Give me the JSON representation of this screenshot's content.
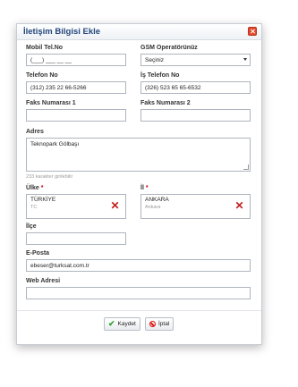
{
  "dialog": {
    "title": "İletişim Bilgisi Ekle"
  },
  "fields": {
    "mobile": {
      "label": "Mobil Tel.No",
      "value": "(___) ___ __ __"
    },
    "gsm_operator": {
      "label": "GSM Operatörünüz",
      "value": "Seçiniz"
    },
    "phone": {
      "label": "Telefon No",
      "value": "(312) 235 22 66-5266"
    },
    "work_phone": {
      "label": "İş Telefon No",
      "value": "(326) 523 65 65-6532"
    },
    "fax1": {
      "label": "Faks Numarası 1",
      "value": ""
    },
    "fax2": {
      "label": "Faks Numarası 2",
      "value": ""
    },
    "address": {
      "label": "Adres",
      "value": "Teknopark Gölbaşı",
      "hint": "233 karakter girilebilir"
    },
    "country": {
      "label": "Ülke",
      "required_mark": "*",
      "value": "TÜRKİYE",
      "code": "TC"
    },
    "city": {
      "label": "İl",
      "required_mark": "*",
      "value": "ANKARA",
      "sub": "Ankara"
    },
    "district": {
      "label": "İlçe",
      "value": ""
    },
    "email": {
      "label": "E-Posta",
      "value": "ebeser@turksat.com.tr"
    },
    "web": {
      "label": "Web Adresi",
      "value": ""
    }
  },
  "buttons": {
    "save": "Kaydet",
    "cancel": "İptal"
  },
  "colors": {
    "title": "#24477c",
    "required": "#d0021b",
    "remove": "#c21f1f",
    "save_icon": "#3aa13a"
  }
}
